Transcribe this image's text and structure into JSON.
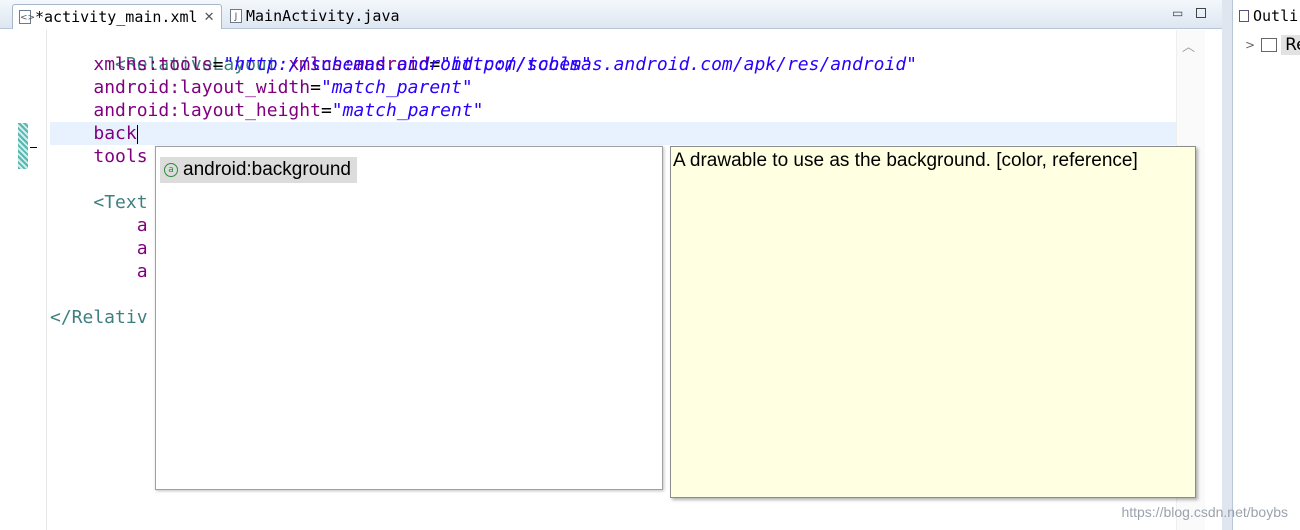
{
  "tabs": [
    {
      "label": "*activity_main.xml",
      "icon": "xml-file-icon",
      "close": "✕"
    },
    {
      "label": "MainActivity.java",
      "icon": "java-file-icon"
    }
  ],
  "window_controls": {
    "minimize": "▭",
    "maximize": ""
  },
  "code_lines": {
    "l1": {
      "tag": "<RelativeLayout",
      "attr": "xmlns:android",
      "eq": "=",
      "val": "\"http://schemas.android.com/apk/res/android\""
    },
    "l2": {
      "attr": "xmlns:tools",
      "eq": "=",
      "val": "\"http://schemas.android.com/tools\""
    },
    "l3": {
      "attr": "android:layout_width",
      "eq": "=",
      "val": "\"match_parent\""
    },
    "l4": {
      "attr": "android:layout_height",
      "eq": "=",
      "val": "\"match_parent\""
    },
    "l5": {
      "attr": "back"
    },
    "l6": {
      "attr": "tools"
    },
    "l8": {
      "tag": "<Text"
    },
    "l9": {
      "attr": "a"
    },
    "l10": {
      "attr": "a"
    },
    "l11": {
      "attr": "a"
    },
    "l13": {
      "tag": "</Relativ"
    }
  },
  "autocomplete": {
    "items": [
      {
        "label": "android:background",
        "icon": "attribute-icon",
        "icon_glyph": "a"
      }
    ]
  },
  "documentation": {
    "text": "A drawable to use as the background. [color, reference]"
  },
  "outline": {
    "tab_label": "Outli",
    "row_label": "Re"
  },
  "watermark": "https://blog.csdn.net/boybs",
  "colors": {
    "tag": "#3f7f7f",
    "attribute": "#7f007f",
    "value": "#2a00ff",
    "doc_background": "#ffffe1",
    "current_line": "#e8f2fe"
  }
}
